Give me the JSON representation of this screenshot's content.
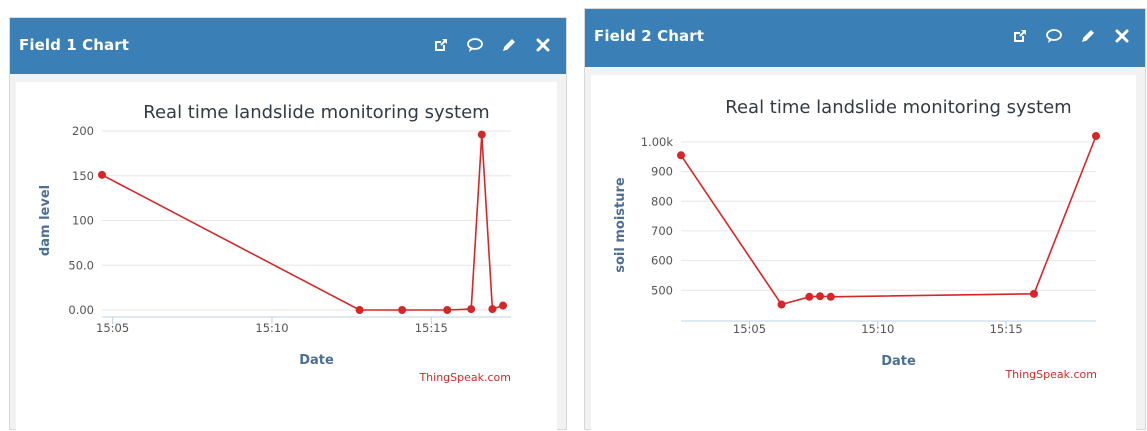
{
  "accent_color": "#3a7fb5",
  "series_color": "#d62728",
  "panels": [
    {
      "header": {
        "title": "Field 1 Chart",
        "icons": [
          "external-link-icon",
          "comment-icon",
          "pencil-icon",
          "close-icon"
        ]
      },
      "credit": "ThingSpeak.com"
    },
    {
      "header": {
        "title": "Field 2 Chart",
        "icons": [
          "external-link-icon",
          "comment-icon",
          "pencil-icon",
          "close-icon"
        ]
      },
      "credit": "ThingSpeak.com"
    }
  ],
  "chart_data": [
    {
      "type": "line",
      "title": "Real time landslide monitoring system",
      "xlabel": "Date",
      "ylabel": "dam level",
      "xlim": [
        "15:04:40",
        "15:17:30"
      ],
      "ylim": [
        0,
        200
      ],
      "yticks": [
        0,
        50,
        100,
        150,
        200
      ],
      "ytick_labels": [
        "0.00",
        "50.0",
        "100",
        "150",
        "200"
      ],
      "xticks": [
        "15:05",
        "15:10",
        "15:15"
      ],
      "grid": true,
      "series": [
        {
          "x": [
            "15:04:40",
            "15:12:45",
            "15:14:05",
            "15:15:30",
            "15:16:15",
            "15:16:35",
            "15:16:55",
            "15:17:15"
          ],
          "values": [
            151,
            0,
            0,
            0,
            1,
            196,
            1,
            5
          ]
        }
      ]
    },
    {
      "type": "line",
      "title": "Real time landslide monitoring system",
      "xlabel": "Date",
      "ylabel": "soil moisture",
      "xlim": [
        "15:02:20",
        "15:18:30"
      ],
      "ylim": [
        420,
        1020
      ],
      "yticks": [
        500,
        600,
        700,
        800,
        900,
        1000
      ],
      "ytick_labels": [
        "500",
        "600",
        "700",
        "800",
        "900",
        "1.00k"
      ],
      "xticks": [
        "15:05",
        "15:10",
        "15:15"
      ],
      "grid": true,
      "series": [
        {
          "x": [
            "15:02:20",
            "15:06:15",
            "15:07:20",
            "15:07:45",
            "15:08:10",
            "15:16:05",
            "15:18:30"
          ],
          "values": [
            955,
            452,
            478,
            480,
            478,
            488,
            1020
          ]
        }
      ]
    }
  ]
}
